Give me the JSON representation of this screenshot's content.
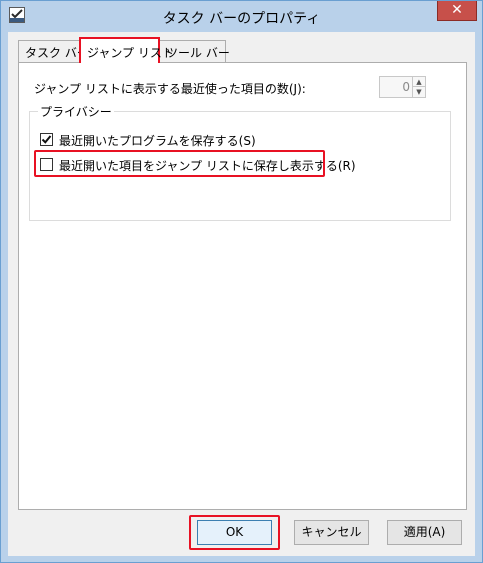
{
  "window": {
    "title": "タスク バーのプロパティ",
    "close_glyph": "✕"
  },
  "tabs": [
    {
      "label": "タスク バー",
      "active": false
    },
    {
      "label": "ジャンプ リスト",
      "active": true
    },
    {
      "label": "ツール バー",
      "active": false
    }
  ],
  "jumplist": {
    "recent_count_label": "ジャンプ リストに表示する最近使った項目の数(J):",
    "recent_count_value": "0",
    "privacy_group_label": "プライバシー",
    "options": [
      {
        "label": "最近開いたプログラムを保存する(S)",
        "checked": true
      },
      {
        "label": "最近開いた項目をジャンプ リストに保存し表示する(R)",
        "checked": false
      }
    ]
  },
  "buttons": {
    "ok": "OK",
    "cancel": "キャンセル",
    "apply": "適用(A)"
  },
  "colors": {
    "highlight": "#e81123",
    "titlebar": "#b9d1ea",
    "close": "#c7504a"
  },
  "icons": {
    "app": "taskbar-properties-icon",
    "checkmark": "checkmark-icon",
    "spin_up": "spin-up-arrow-icon",
    "spin_down": "spin-down-arrow-icon"
  }
}
